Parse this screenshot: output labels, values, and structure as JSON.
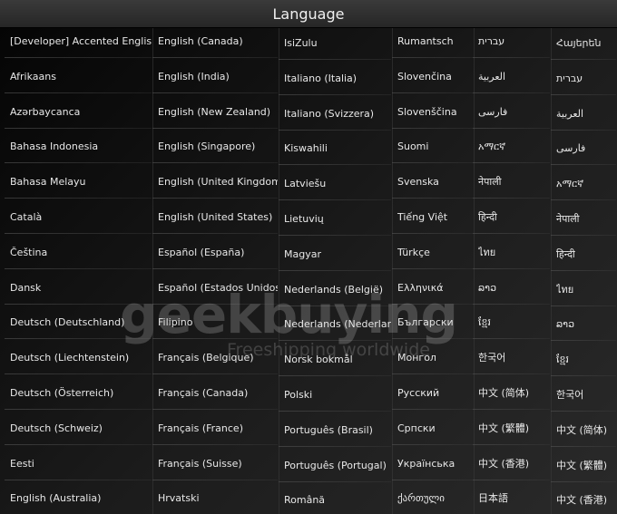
{
  "header": {
    "title": "Language"
  },
  "watermark": {
    "logo": "geekbuying",
    "tagline": "Freeshipping worldwide"
  },
  "columns": [
    {
      "id": "col1",
      "items": [
        "[Developer] Accented English",
        "Afrikaans",
        "Azərbaycanca",
        "Bahasa Indonesia",
        "Bahasa Melayu",
        "Català",
        "Čeština",
        "Dansk",
        "Deutsch (Deutschland)",
        "Deutsch (Liechtenstein)",
        "Deutsch (Österreich)",
        "Deutsch (Schweiz)",
        "Eesti",
        "English (Australia)"
      ]
    },
    {
      "id": "col2",
      "items": [
        "English (Canada)",
        "English (India)",
        "English (New Zealand)",
        "English (Singapore)",
        "English (United Kingdom)",
        "English (United States)",
        "Español (España)",
        "Español (Estados Unidos)",
        "Filipino",
        "Français (Belgique)",
        "Français (Canada)",
        "Français (France)",
        "Français (Suisse)",
        "Hrvatski"
      ]
    },
    {
      "id": "col3",
      "items": [
        "IsiZulu",
        "Italiano (Italia)",
        "Italiano (Svizzera)",
        "Kiswahili",
        "Latviešu",
        "Lietuvių",
        "Magyar",
        "Nederlands (België)",
        "Nederlands (Nederland)",
        "Norsk bokmål",
        "Polski",
        "Português (Brasil)",
        "Português (Portugal)",
        "Română"
      ]
    },
    {
      "id": "col4",
      "items": [
        "Rumantsch",
        "Slovenčina",
        "Slovenščina",
        "Suomi",
        "Svenska",
        "Tiếng Việt",
        "Türkçe",
        "Ελληνικά",
        "Български",
        "Монгол",
        "Русский",
        "Српски",
        "Українська",
        "ქართული"
      ]
    },
    {
      "id": "col5",
      "items": [
        "עברית",
        "العربية",
        "فارسی",
        "አማርኛ",
        "नेपाली",
        "हिन्दी",
        "ไทย",
        "ລາວ",
        "ខ្មែរ",
        "한국어",
        "中文 (简体)",
        "中文 (繁體)",
        "中文 (香港)",
        "日本語"
      ]
    },
    {
      "id": "col6",
      "items": [
        "Հայերեն",
        "עברית",
        "العربية",
        "فارسی",
        "አማርኛ",
        "नेपाली",
        "हिन्दी",
        "ไทย",
        "ລາວ",
        "ខ្មែរ",
        "한국어",
        "中文 (简体)",
        "中文 (繁體)",
        "中文 (香港)"
      ]
    }
  ]
}
